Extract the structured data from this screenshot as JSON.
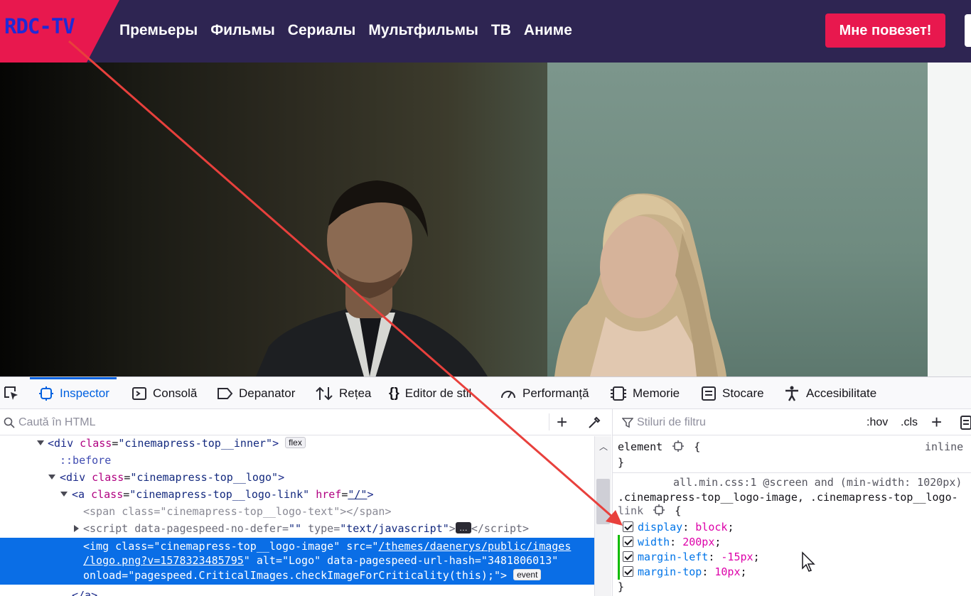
{
  "site": {
    "logo": "RDC-TV",
    "nav": [
      "Премьеры",
      "Фильмы",
      "Сериалы",
      "Мультфильмы",
      "ТВ",
      "Аниме"
    ],
    "lucky_button": "Мне повезет!"
  },
  "devtools": {
    "tabs": [
      {
        "label": "Inspector",
        "icon": "inspector-icon",
        "active": true
      },
      {
        "label": "Consolă",
        "icon": "console-icon"
      },
      {
        "label": "Depanator",
        "icon": "debugger-icon"
      },
      {
        "label": "Rețea",
        "icon": "network-icon"
      },
      {
        "label": "Editor de stil",
        "icon": "style-editor-icon"
      },
      {
        "label": "Performanță",
        "icon": "performance-icon"
      },
      {
        "label": "Memorie",
        "icon": "memory-icon"
      },
      {
        "label": "Stocare",
        "icon": "storage-icon"
      },
      {
        "label": "Accesibilitate",
        "icon": "accessibility-icon"
      }
    ],
    "html_search_placeholder": "Caută în HTML",
    "markup": {
      "l1_tag_open": "<div",
      "l1_attr": "class",
      "l1_val": "\"cinemapress-top__inner\"",
      "l1_badge": "flex",
      "l2": "::before",
      "l3_attr": "class",
      "l3_val": "\"cinemapress-top__logo\"",
      "l4_attr1": "class",
      "l4_val1": "\"cinemapress-top__logo-link\"",
      "l4_attr2": "href",
      "l4_val2": "\"/\"",
      "l5_attr": "class",
      "l5_val": "\"cinemapress-top__logo-text\"",
      "l6_attr1": "data-pagespeed-no-defer",
      "l6_val1": "\"\"",
      "l6_attr2": "type",
      "l6_val2": "\"text/javascript\"",
      "l6_badge": "…",
      "sel_line1": "<img class=\"cinemapress-top__logo-image\" src=\"",
      "sel_line1_link": "/themes/daenerys/public/images",
      "sel_line2_link": "/logo.png?v=1578323485795",
      "sel_line2_rest": "\" alt=\"Logo\" data-pagespeed-url-hash=\"3481806013\"",
      "sel_line3": "onload=\"pagespeed.CriticalImages.checkImageForCriticality(this);\">",
      "sel_badge": "event",
      "l8": "</a>"
    },
    "rules_search_placeholder": "Stiluri de filtru",
    "hov": ":hov",
    ".cls": ".cls",
    "rules": {
      "element_selector": "element",
      "element_source": "inline",
      "rule_source": "all.min.css:1 @screen and (min-width: 1020px)",
      "selector_line1": ".cinemapress-top__logo-image, .cinemapress-top__logo-",
      "selector_line2": "link",
      "declarations": [
        {
          "prop": "display",
          "value": "block"
        },
        {
          "prop": "width",
          "value": "200px"
        },
        {
          "prop": "margin-left",
          "value": "-15px"
        },
        {
          "prop": "margin-top",
          "value": "10px"
        }
      ]
    }
  },
  "colors": {
    "header_bg": "#2e2552",
    "accent": "#e8184e",
    "logo_text": "#1f2ad6",
    "selection": "#0a6ee6",
    "arrow": "#e8403c"
  }
}
